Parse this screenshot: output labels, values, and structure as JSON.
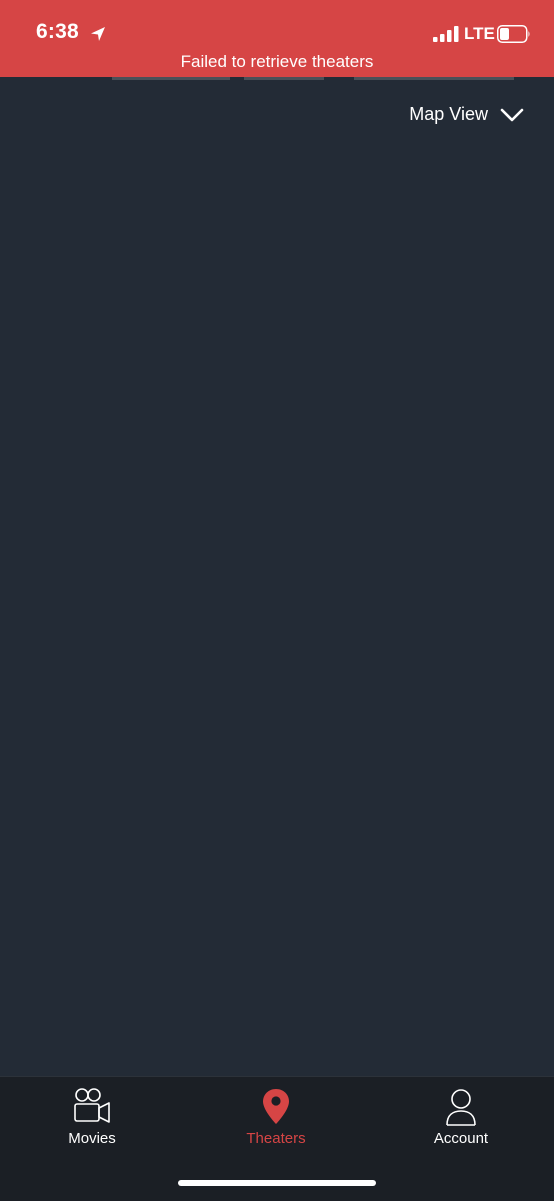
{
  "status_bar": {
    "time": "6:38",
    "network": "LTE",
    "location_icon": "location-arrow-icon",
    "signal_icon": "cellular-signal-icon",
    "battery_icon": "battery-low-icon"
  },
  "banner": {
    "message": "Failed to retrieve theaters"
  },
  "view_toggle": {
    "label": "Map View",
    "icon": "chevron-down-icon"
  },
  "tabs": [
    {
      "label": "Movies",
      "icon": "movie-camera-icon",
      "active": false
    },
    {
      "label": "Theaters",
      "icon": "map-pin-icon",
      "active": true
    },
    {
      "label": "Account",
      "icon": "person-icon",
      "active": false
    }
  ],
  "colors": {
    "accent": "#d64545",
    "background": "#232b36",
    "tab_bar": "#1b1f25",
    "text": "#ffffff"
  }
}
